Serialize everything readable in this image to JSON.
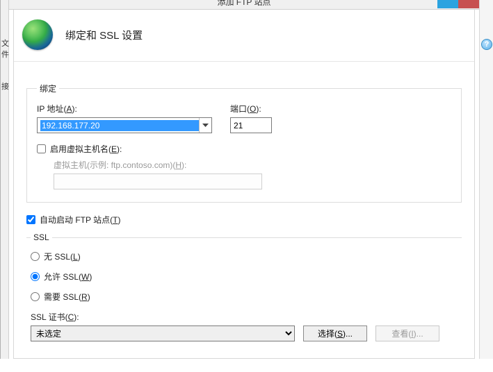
{
  "window": {
    "title": "添加 FTP 站点"
  },
  "left_tags": {
    "a": "文件",
    "b": "接"
  },
  "header": {
    "title": "绑定和 SSL 设置"
  },
  "binding": {
    "legend": "绑定",
    "ip_label_pre": "IP 地址(",
    "ip_label_ul": "A",
    "ip_label_post": "):",
    "ip_value": "192.168.177.20",
    "port_label_pre": "端口(",
    "port_label_ul": "O",
    "port_label_post": "):",
    "port_value": "21",
    "vhost_cb_label_pre": "启用虚拟主机名(",
    "vhost_cb_label_ul": "E",
    "vhost_cb_label_post": "):",
    "vhost_field_label_pre": "虚拟主机(示例: ftp.contoso.com)(",
    "vhost_field_label_ul": "H",
    "vhost_field_label_post": "):"
  },
  "autostart": {
    "label_pre": "自动启动 FTP 站点(",
    "label_ul": "T",
    "label_post": ")"
  },
  "ssl": {
    "legend": "SSL",
    "opt_none_pre": "无 SSL(",
    "opt_none_ul": "L",
    "opt_none_post": ")",
    "opt_allow_pre": "允许 SSL(",
    "opt_allow_ul": "W",
    "opt_allow_post": ")",
    "opt_require_pre": "需要 SSL(",
    "opt_require_ul": "R",
    "opt_require_post": ")",
    "cert_label_pre": "SSL 证书(",
    "cert_label_ul": "C",
    "cert_label_post": "):",
    "cert_value": "未选定",
    "select_btn_pre": "选择(",
    "select_btn_ul": "S",
    "select_btn_post": ")...",
    "view_btn_pre": "查看(",
    "view_btn_ul": "I",
    "view_btn_post": ")..."
  }
}
